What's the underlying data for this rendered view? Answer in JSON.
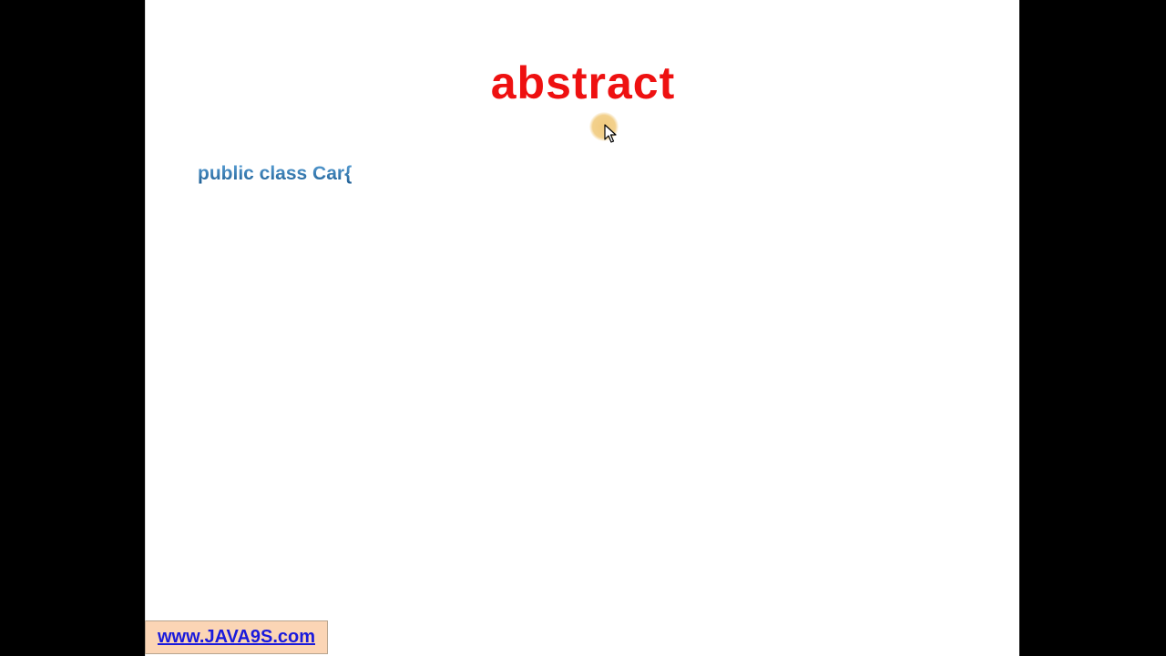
{
  "slide": {
    "title": "abstract",
    "title_color": "#ee1111",
    "code_line": "public class Car{",
    "code_color": "#2e7ab8",
    "background": "#ffffff"
  },
  "pointer": {
    "icon": "mouse-cursor-arrow-icon",
    "halo_color": "#f0c878"
  },
  "watermark": {
    "link_text": "www.JAVA9S.com",
    "background": "#fbd5b5",
    "link_color": "#1a1adc"
  },
  "frame": {
    "letterbox_color": "#000000"
  }
}
